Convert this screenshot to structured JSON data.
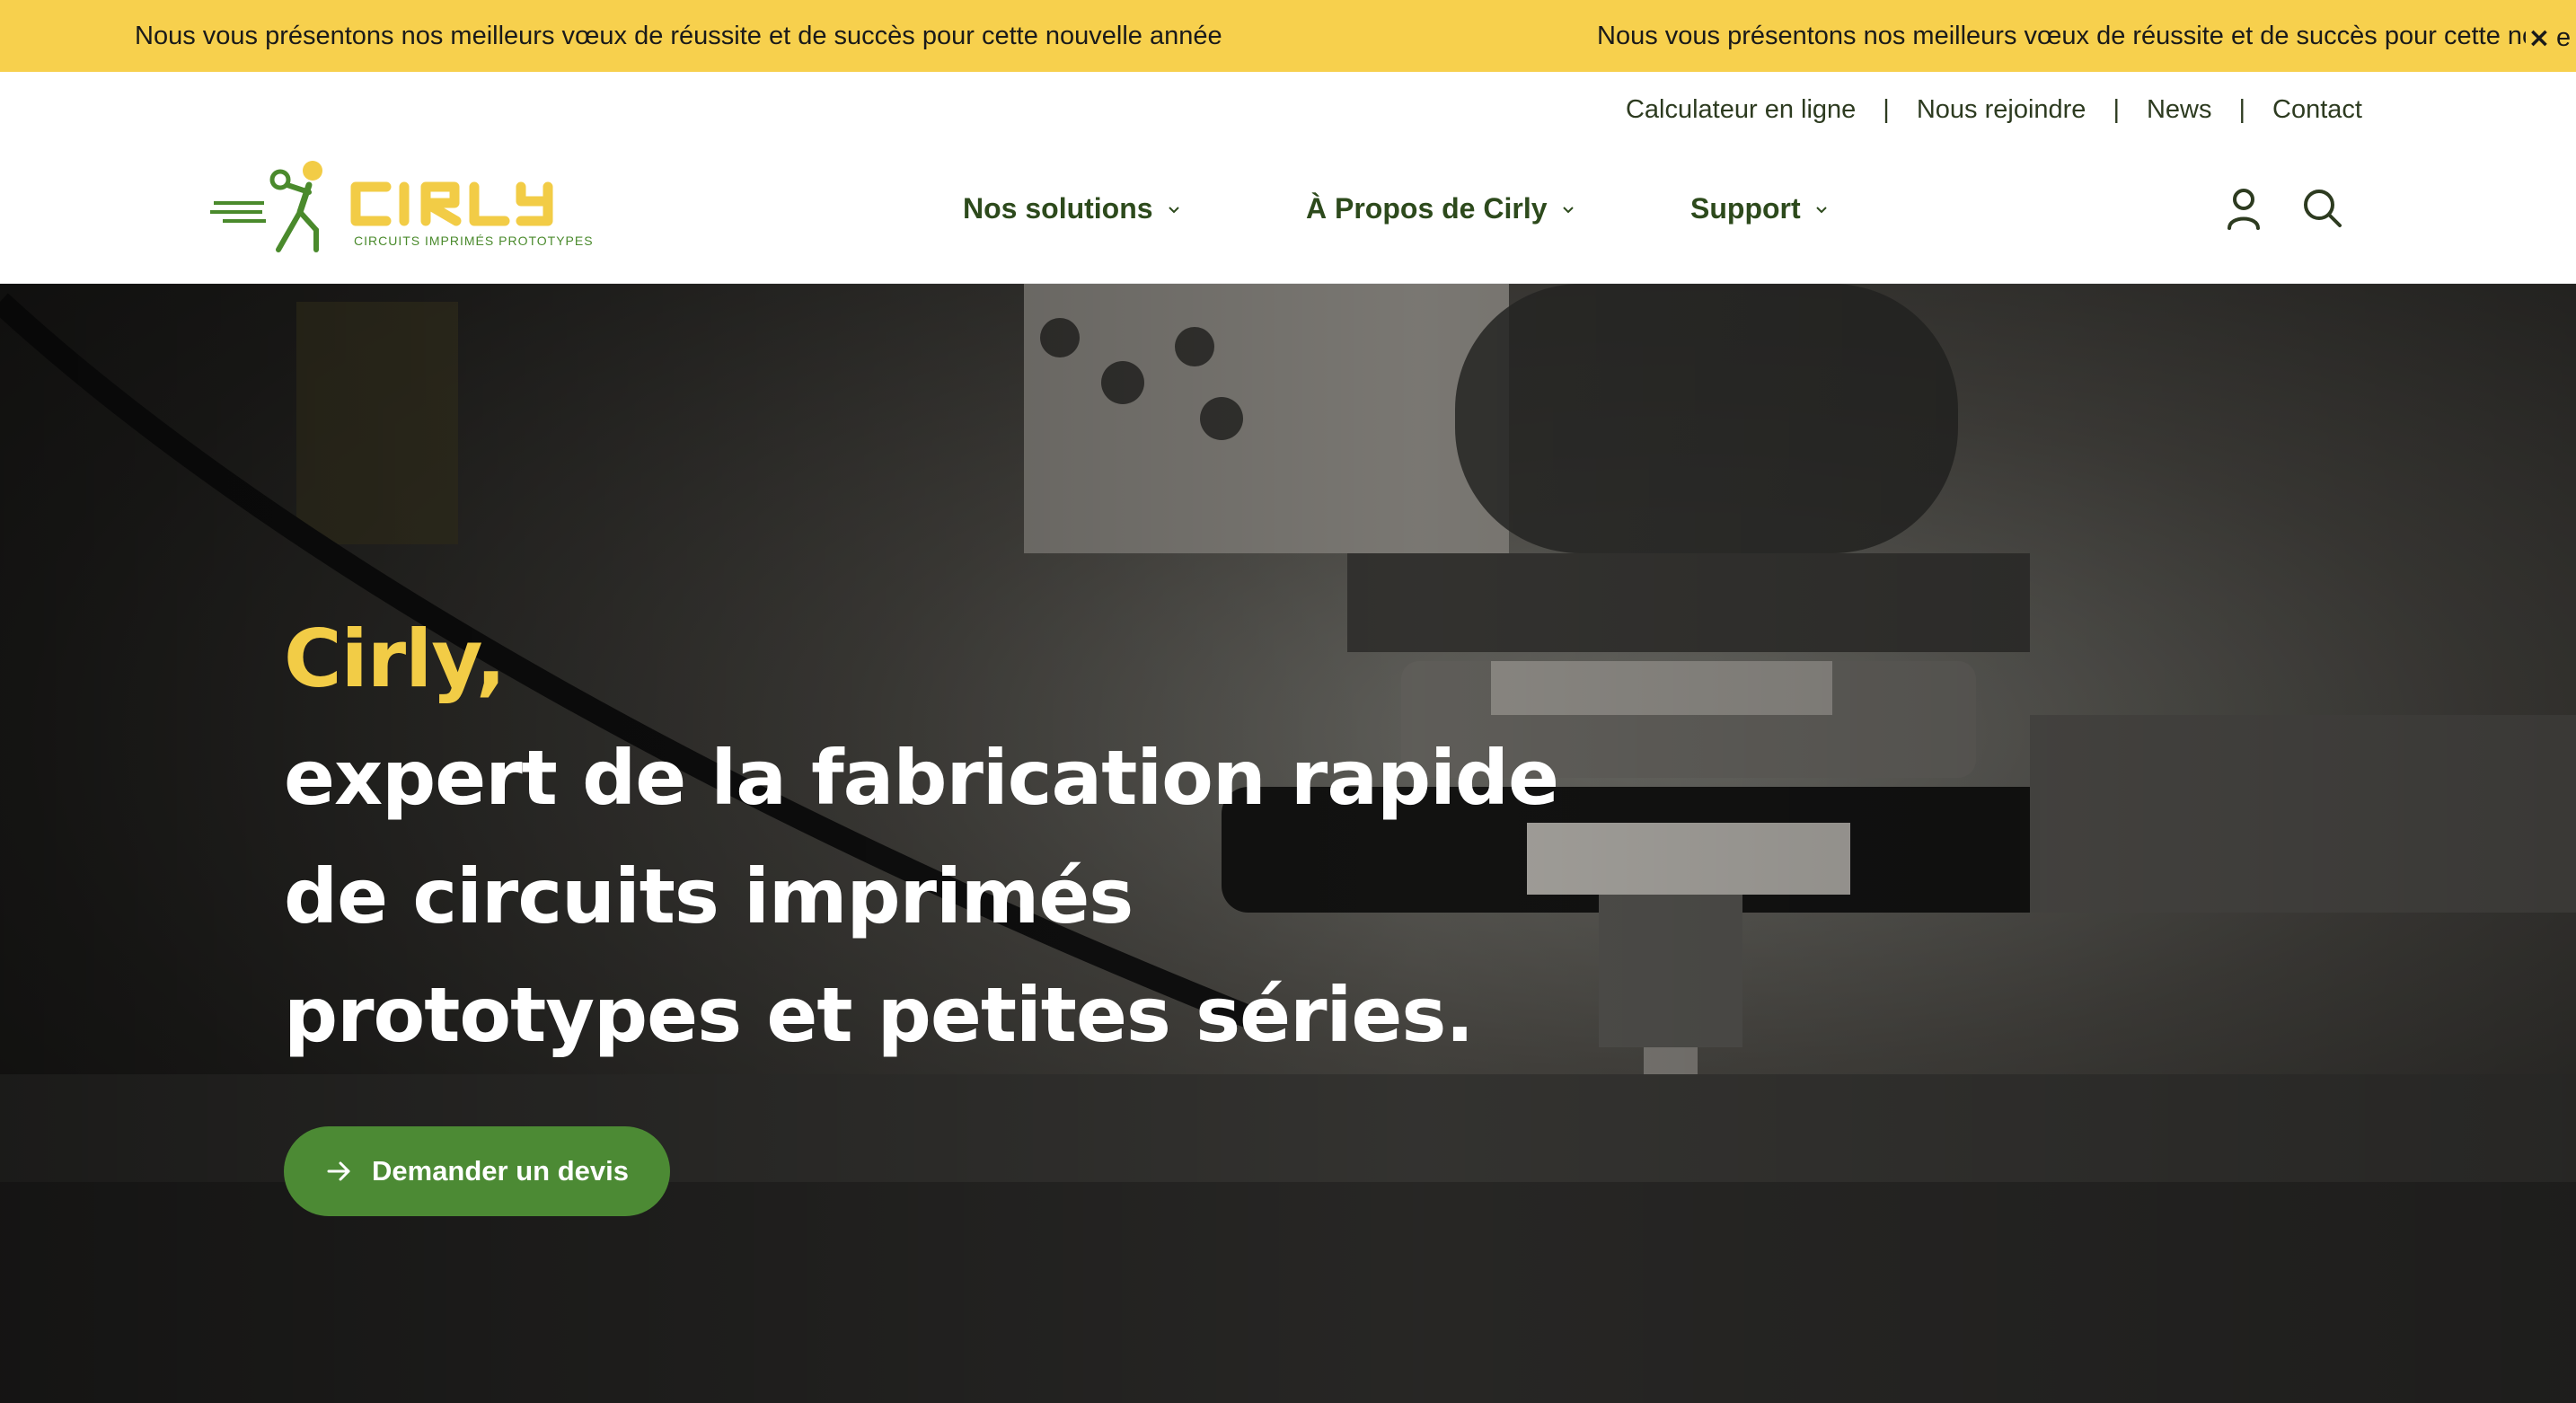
{
  "announcement": {
    "message": "Nous vous présentons nos meilleurs vœux de réussite et de succès pour cette nouvelle année",
    "message_repeat": "Nous vous présentons nos meilleurs vœux de réussite et de succès pour cette nou",
    "message_tail": "e",
    "close_label": "×",
    "background": "#f7d04d"
  },
  "top_links": [
    {
      "label": "Calculateur en ligne"
    },
    {
      "label": "Nous rejoindre"
    },
    {
      "label": "News"
    },
    {
      "label": "Contact"
    }
  ],
  "separator": "|",
  "logo": {
    "name": "CIRLY",
    "tagline": "CIRCUITS IMPRIMÉS PROTOTYPES",
    "color_text": "#f2cc46",
    "color_figure": "#4a8a2c"
  },
  "main_nav": [
    {
      "label": "Nos solutions",
      "icon": "chevron-down-icon"
    },
    {
      "label": "À Propos de Cirly",
      "icon": "chevron-down-icon"
    },
    {
      "label": "Support",
      "icon": "chevron-down-icon"
    }
  ],
  "header_icons": {
    "account": "user-icon",
    "search": "search-icon"
  },
  "hero": {
    "brand": "Cirly,",
    "lines": [
      "expert de la fabrication rapide",
      "de circuits imprimés",
      "prototypes et petites séries."
    ],
    "cta_label": "Demander un devis",
    "cta_icon": "arrow-right-icon"
  },
  "colors": {
    "accent_yellow": "#f2cc46",
    "brand_green": "#4c8a34",
    "nav_text": "#2d4a1c"
  }
}
